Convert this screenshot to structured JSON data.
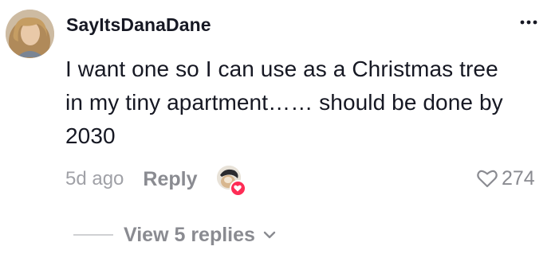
{
  "comment": {
    "username": "SayItsDanaDane",
    "text_lines": [
      "I want one so I can use as a Christmas tree",
      "in my tiny apartment…… should be done by",
      "2030"
    ],
    "timestamp": "5d ago",
    "reply_label": "Reply",
    "like_count": "274",
    "view_replies_label": "View 5 replies"
  },
  "colors": {
    "text_primary": "#161823",
    "text_secondary": "#8a8b91",
    "heart_badge": "#fe2c55"
  },
  "icons": {
    "more": "more-horizontal-icon",
    "like": "heart-outline-icon",
    "creator_liked": "heart-filled-icon",
    "view_replies": "chevron-down-icon"
  }
}
